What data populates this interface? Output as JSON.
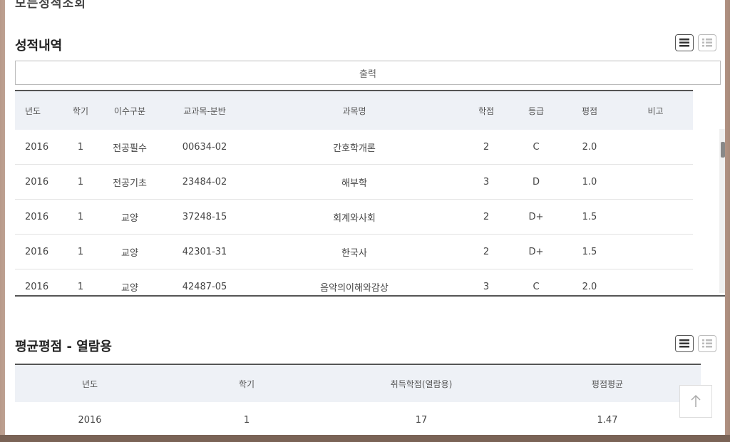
{
  "page": {
    "cut_title": "모든성적조회"
  },
  "grades": {
    "title": "성적내역",
    "print_label": "출력",
    "view_list_icon": "list-view-icon",
    "view_grid_icon": "detail-view-icon",
    "headers": [
      "년도",
      "학기",
      "이수구분",
      "교과목-분반",
      "과목명",
      "학점",
      "등급",
      "평점",
      "비고"
    ],
    "rows": [
      [
        "2016",
        "1",
        "전공필수",
        "00634-02",
        "간호학개론",
        "2",
        "C",
        "2.0",
        ""
      ],
      [
        "2016",
        "1",
        "전공기초",
        "23484-02",
        "해부학",
        "3",
        "D",
        "1.0",
        ""
      ],
      [
        "2016",
        "1",
        "교양",
        "37248-15",
        "회계와사회",
        "2",
        "D+",
        "1.5",
        ""
      ],
      [
        "2016",
        "1",
        "교양",
        "42301-31",
        "한국사",
        "2",
        "D+",
        "1.5",
        ""
      ],
      [
        "2016",
        "1",
        "교양",
        "42487-05",
        "음악의이해와감상",
        "3",
        "C",
        "2.0",
        ""
      ]
    ]
  },
  "average": {
    "title": "평균평점 - 열람용",
    "headers": [
      "년도",
      "학기",
      "취득학점(열람용)",
      "평점평균"
    ],
    "rows": [
      [
        "2016",
        "1",
        "17",
        "1.47"
      ]
    ]
  },
  "scroll_top_icon": "arrow-up-icon"
}
